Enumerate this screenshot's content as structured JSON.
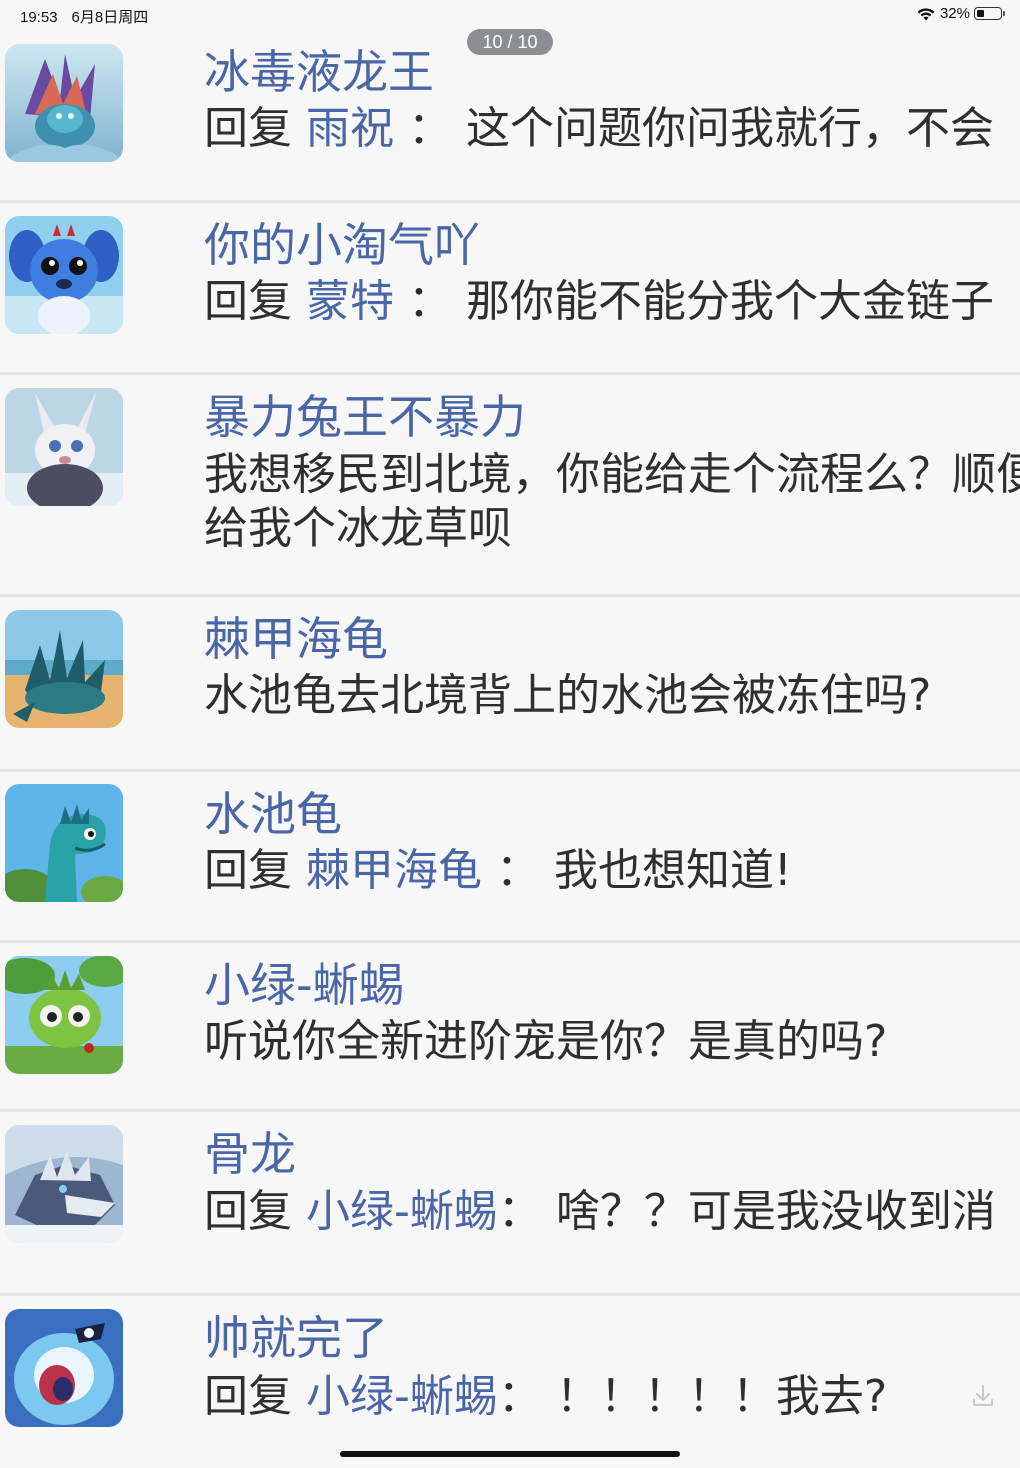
{
  "status_bar": {
    "time": "19:53",
    "date": "6月8日周四",
    "battery": "32%",
    "battery_level": 0.32
  },
  "page_indicator": "10 / 10",
  "comments": [
    {
      "name": "冰毒液龙王",
      "reply_prefix": "回复 ",
      "reply_to": "雨祝",
      "separator": " ： ",
      "text": "这个问题你问我就行，不会",
      "avatar": "ice-venom-dragon-king-avatar"
    },
    {
      "name": "你的小淘气吖",
      "reply_prefix": "回复 ",
      "reply_to": "蒙特",
      "separator": " ： ",
      "text": "那你能不能分我个大金链子",
      "avatar": "blue-puppy-avatar"
    },
    {
      "name": "暴力兔王不暴力",
      "text": "我想移民到北境，你能给走个流程么？顺便给我个冰龙草呗",
      "avatar": "rabbit-king-avatar"
    },
    {
      "name": "棘甲海龟",
      "text": "水池龟去北境背上的水池会被冻住吗?",
      "avatar": "spiked-sea-turtle-avatar"
    },
    {
      "name": "水池龟",
      "reply_prefix": "回复 ",
      "reply_to": "棘甲海龟",
      "separator": " ： ",
      "text": "我也想知道!",
      "avatar": "pool-turtle-avatar"
    },
    {
      "name": "小绿-蜥蜴",
      "text": "听说你全新进阶宠是你？是真的吗?",
      "avatar": "green-lizard-avatar"
    },
    {
      "name": "骨龙",
      "reply_prefix": "回复 ",
      "reply_to": "小绿-蜥蜴",
      "separator": "： ",
      "text": "啥？？可是我没收到消",
      "avatar": "bone-dragon-avatar"
    },
    {
      "name": "帅就完了",
      "reply_prefix": "回复 ",
      "reply_to": "小绿-蜥蜴",
      "separator": "： ",
      "text": "！！！！！我去?",
      "avatar": "cool-creature-avatar"
    }
  ],
  "icons": {
    "wifi": "wifi-icon",
    "battery": "battery-icon",
    "download": "download-icon"
  },
  "colors": {
    "name": "#4a66a6",
    "text": "#2f2f2f",
    "background": "#f7f7f8",
    "divider": "#e4e4e6",
    "pill": "#8d8e92"
  }
}
